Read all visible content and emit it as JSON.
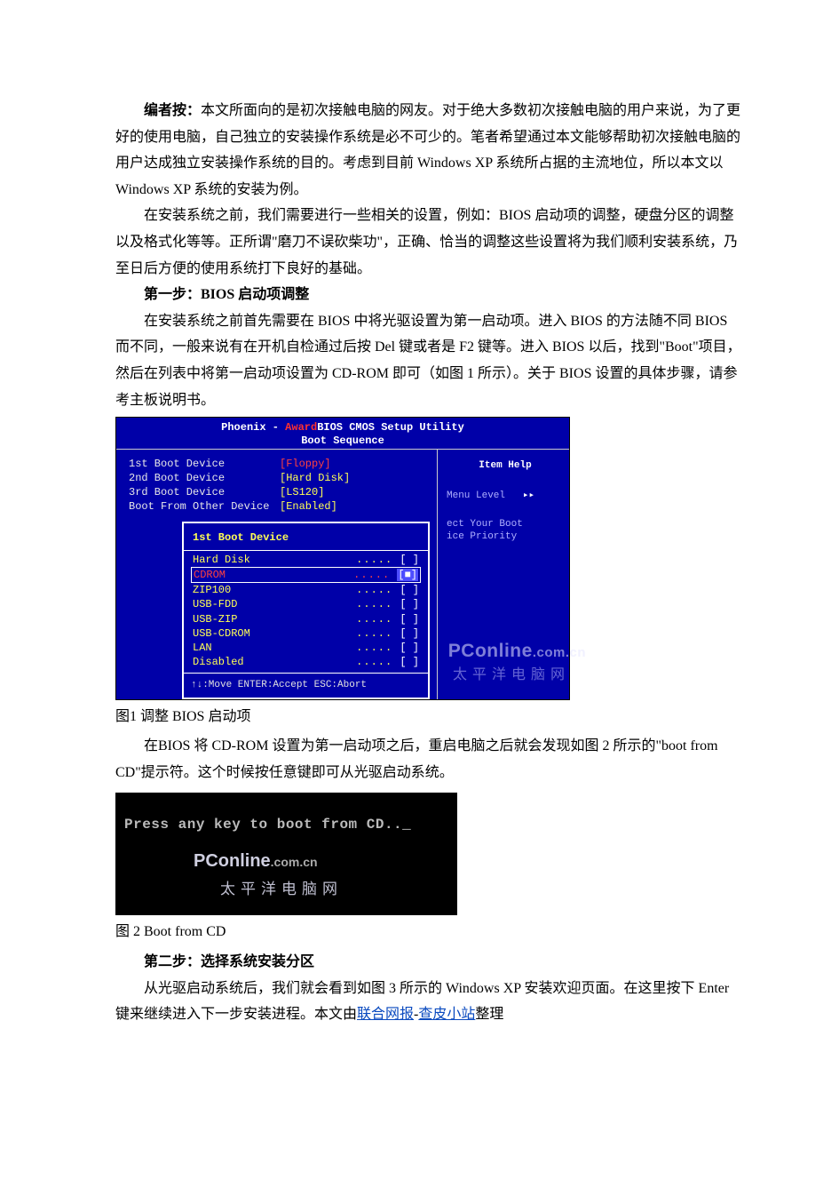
{
  "intro": {
    "para1": "编者按：本文所面向的是初次接触电脑的网友。对于绝大多数初次接触电脑的用户来说，为了更好的使用电脑，自己独立的安装操作系统是必不可少的。笔者希望通过本文能够帮助初次接触电脑的用户达成独立安装操作系统的目的。考虑到目前 Windows XP 系统所占据的主流地位，所以本文以 Windows XP 系统的安装为例。",
    "para2": "在安装系统之前，我们需要进行一些相关的设置，例如：BIOS 启动项的调整，硬盘分区的调整以及格式化等等。正所谓\"磨刀不误砍柴功\"，正确、恰当的调整这些设置将为我们顺利安装系统，乃至日后方便的使用系统打下良好的基础。"
  },
  "step1": {
    "title": "第一步：BIOS 启动项调整",
    "para": "在安装系统之前首先需要在 BIOS 中将光驱设置为第一启动项。进入 BIOS 的方法随不同 BIOS 而不同，一般来说有在开机自检通过后按 Del 键或者是 F2 键等。进入 BIOS 以后，找到\"Boot\"项目，然后在列表中将第一启动项设置为 CD-ROM 即可（如图 1 所示）。关于 BIOS 设置的具体步骤，请参考主板说明书。"
  },
  "bios": {
    "title1": "Phoenix - AwardBIOS CMOS Setup Utility",
    "title2": "Boot Sequence",
    "items": [
      {
        "label": "1st Boot Device",
        "value": "[Floppy]",
        "red": true
      },
      {
        "label": "2nd Boot Device",
        "value": "[Hard Disk]"
      },
      {
        "label": "3rd Boot Device",
        "value": "[LS120]"
      },
      {
        "label": "Boot From Other Device",
        "value": "[Enabled]"
      }
    ],
    "popup": {
      "title": "1st Boot Device",
      "options": [
        {
          "name": "Hard Disk",
          "mark": "[ ]"
        },
        {
          "name": "CDROM",
          "mark": "[■]",
          "selected": true
        },
        {
          "name": "ZIP100",
          "mark": "[ ]"
        },
        {
          "name": "USB-FDD",
          "mark": "[ ]"
        },
        {
          "name": "USB-ZIP",
          "mark": "[ ]"
        },
        {
          "name": "USB-CDROM",
          "mark": "[ ]"
        },
        {
          "name": "LAN",
          "mark": "[ ]"
        },
        {
          "name": "Disabled",
          "mark": "[ ]"
        }
      ],
      "hint": "↑↓:Move ENTER:Accept ESC:Abort"
    },
    "help": {
      "title": "Item Help",
      "menulevel": "Menu Level",
      "arrows": "▸▸",
      "desc1": "ect Your Boot",
      "desc2": "ice Priority"
    },
    "watermark1": "PConline",
    "watermark1b": ".com.cn",
    "watermark2": "太平洋电脑网"
  },
  "caption1": "图1 调整 BIOS 启动项",
  "para3": "在BIOS 将 CD-ROM 设置为第一启动项之后，重启电脑之后就会发现如图 2 所示的\"boot from CD\"提示符。这个时候按任意键即可从光驱启动系统。",
  "bootcd": {
    "text": "Press any key to boot from CD..",
    "cursor": "_",
    "wm1": "PConline",
    "wm1b": ".com.cn",
    "wm2": "太平洋电脑网"
  },
  "caption2": "图 2 Boot from CD",
  "step2": {
    "title": "第二步：选择系统安装分区",
    "para_pre": "从光驱启动系统后，我们就会看到如图 3 所示的 Windows XP 安装欢迎页面。在这里按下 Enter 键来继续进入下一步安装进程。本文由",
    "link1": "联合网报",
    "dash": "-",
    "link2": "查皮小站",
    "para_post": "整理"
  }
}
